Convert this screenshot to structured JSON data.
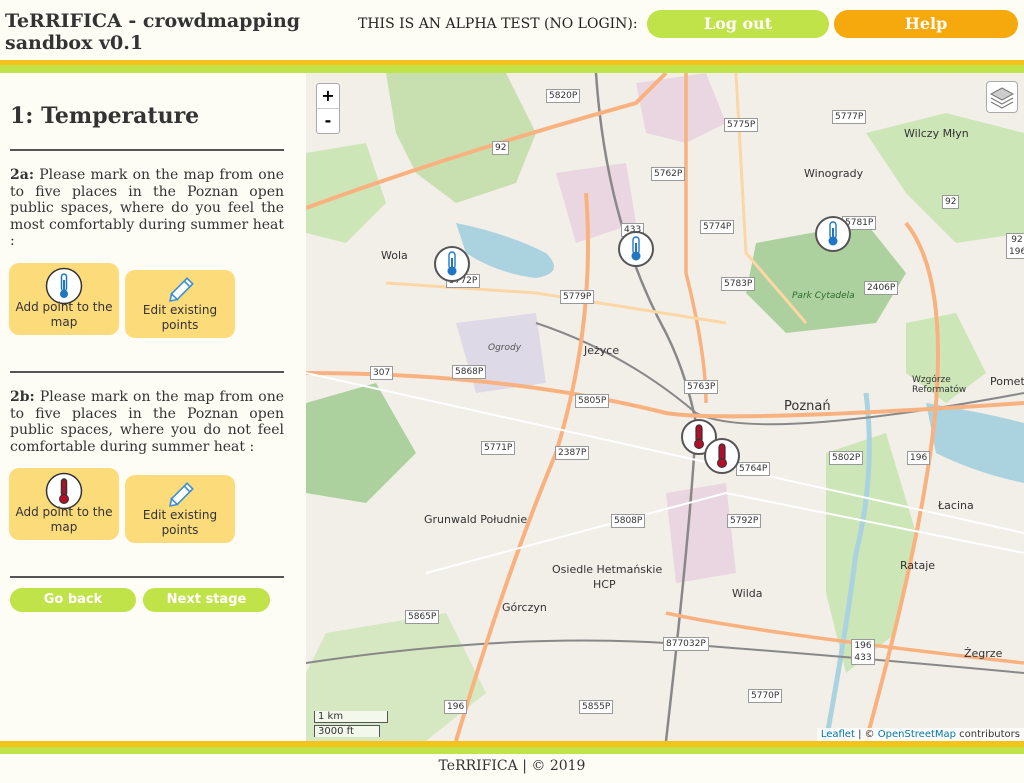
{
  "header": {
    "title": "TeRRIFICA - crowdmapping sandbox v0.1",
    "alpha_note": "THIS IS AN ALPHA TEST (NO LOGIN):",
    "logout_label": "Log out",
    "help_label": "Help"
  },
  "panel": {
    "section_title": "1: Temperature",
    "q2a_label": "2a:",
    "q2a_text": " Please mark on the map from one to five places in the Poznan open public spaces, where do you feel the most comfortably during summer heat :",
    "q2b_label": "2b:",
    "q2b_text": " Please mark on the map from one to five places in the Poznan open public spaces, where you do not feel comfortable during summer heat :",
    "add_point_label": "Add point to the map",
    "edit_points_label": "Edit existing points",
    "go_back_label": "Go back",
    "next_stage_label": "Next stage"
  },
  "map": {
    "zoom_in": "+",
    "zoom_out": "-",
    "scale_km": "1 km",
    "scale_ft": "3000 ft",
    "attribution_leaflet": "Leaflet",
    "attribution_sep": " | © ",
    "attribution_osm": "OpenStreetMap",
    "attribution_tail": " contributors",
    "places": {
      "wola": "Wola",
      "winogrady": "Winogrady",
      "wilczy_mlyn": "Wilczy Młyn",
      "jezyce": "Jeżyce",
      "poznan": "Poznań",
      "grunwald": "Grunwald Południe",
      "osiedle_hetmanskie": "Osiedle Hetmańskie",
      "hcp": "HCP",
      "gorczyn": "Górczyn",
      "wilda": "Wilda",
      "lacina": "Łacina",
      "rataje": "Rataje",
      "zegrze": "Żegrze",
      "park_cytadela": "Park Cytadela",
      "ogrody": "Ogrody",
      "wzgorze": "Wzgórze Reformatów",
      "pomet": "Pomet"
    },
    "roads": [
      "5820P",
      "5775P",
      "5777P",
      "92",
      "5762P",
      "5774P",
      "433",
      "5781P",
      "92",
      "5772P",
      "5779P",
      "5783P",
      "2406P",
      "307",
      "5868P",
      "5763P",
      "5805P",
      "5771P",
      "2387P",
      "5802P",
      "196",
      "5764P",
      "5808P",
      "5792P",
      "5865P",
      "877032P",
      "196",
      "5770P",
      "5855P",
      "196 433",
      "92 196"
    ],
    "comfortable_color": "#1f77c4",
    "uncomfortable_color": "#b0102a"
  },
  "footer": {
    "text": "TeRRIFICA | © 2019"
  }
}
